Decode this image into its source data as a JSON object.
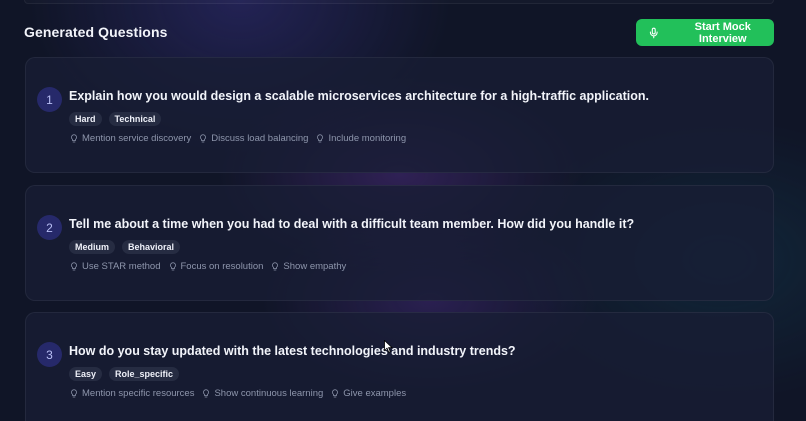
{
  "header": {
    "title": "Generated Questions",
    "start_button": "Start Mock Interview"
  },
  "questions": [
    {
      "number": "1",
      "text": "Explain how you would design a scalable microservices architecture for a high-traffic application.",
      "tags": [
        "Hard",
        "Technical"
      ],
      "tips": [
        "Mention service discovery",
        "Discuss load balancing",
        "Include monitoring"
      ]
    },
    {
      "number": "2",
      "text": "Tell me about a time when you had to deal with a difficult team member. How did you handle it?",
      "tags": [
        "Medium",
        "Behavioral"
      ],
      "tips": [
        "Use STAR method",
        "Focus on resolution",
        "Show empathy"
      ]
    },
    {
      "number": "3",
      "text": "How do you stay updated with the latest technologies and industry trends?",
      "tags": [
        "Easy",
        "Role_specific"
      ],
      "tips": [
        "Mention specific resources",
        "Show continuous learning",
        "Give examples"
      ]
    }
  ],
  "colors": {
    "background": "#101527",
    "accent_green": "#22c05a",
    "number_badge": "#26296a",
    "tag_bg": "#262c42",
    "tip_text": "#8e96ac"
  },
  "icons": {
    "button_icon": "microphone-icon",
    "tip_icon": "lightbulb-icon"
  }
}
